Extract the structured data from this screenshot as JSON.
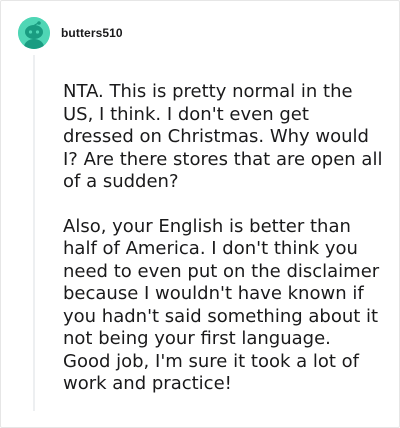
{
  "comment": {
    "author": "butters510",
    "avatar_icon": "snoo-avatar-icon",
    "avatar_color": "#4fd6b5",
    "paragraphs": [
      "NTA. This is pretty normal in the US, I think. I don't even get dressed on Christmas. Why would I? Are there stores that are open all of a sudden?",
      "Also, your English is better than half of America. I don't think you need to even put on the disclaimer because I wouldn't have known if you hadn't said something about it not being your first language. Good job, I'm sure it took a lot of work and practice!"
    ]
  }
}
